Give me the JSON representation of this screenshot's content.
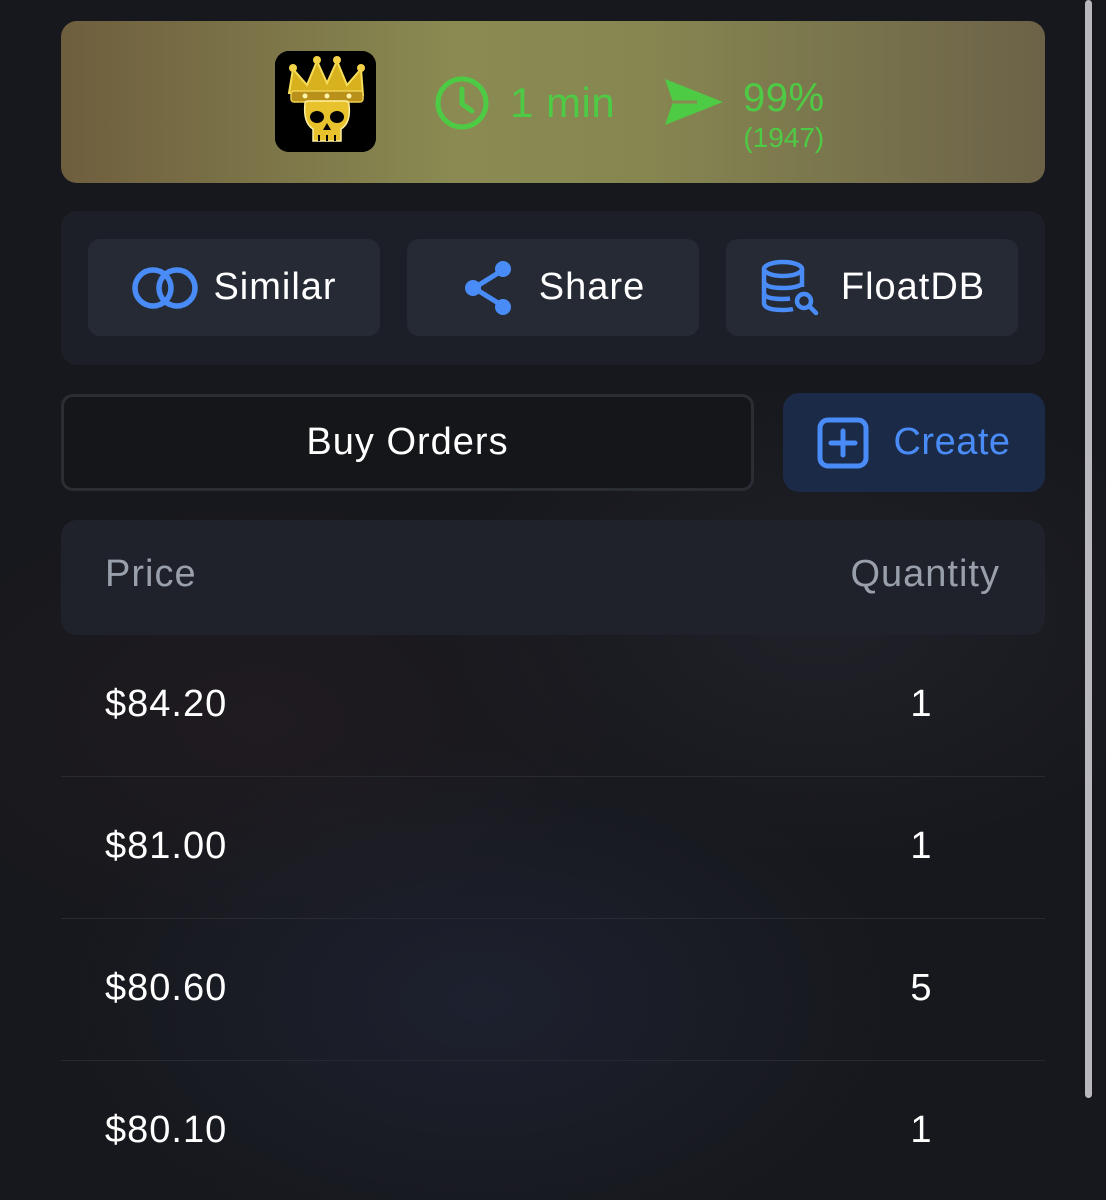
{
  "seller": {
    "avatar_icon": "crown-skull-icon",
    "delivery_time": "1 min",
    "trade_success": "99%",
    "trade_count": "(1947)",
    "accent_color": "#4ecb45"
  },
  "actions": [
    {
      "label": "Similar",
      "icon": "overlapping-circles-icon"
    },
    {
      "label": "Share",
      "icon": "share-icon"
    },
    {
      "label": "FloatDB",
      "icon": "database-search-icon"
    }
  ],
  "orders": {
    "tab_label": "Buy Orders",
    "create_label": "Create",
    "create_icon": "plus-square-icon",
    "accent_color": "#4a8cf7",
    "columns": {
      "price": "Price",
      "quantity": "Quantity"
    },
    "rows": [
      {
        "price": "$84.20",
        "quantity": "1"
      },
      {
        "price": "$81.00",
        "quantity": "1"
      },
      {
        "price": "$80.60",
        "quantity": "5"
      },
      {
        "price": "$80.10",
        "quantity": "1"
      }
    ]
  }
}
